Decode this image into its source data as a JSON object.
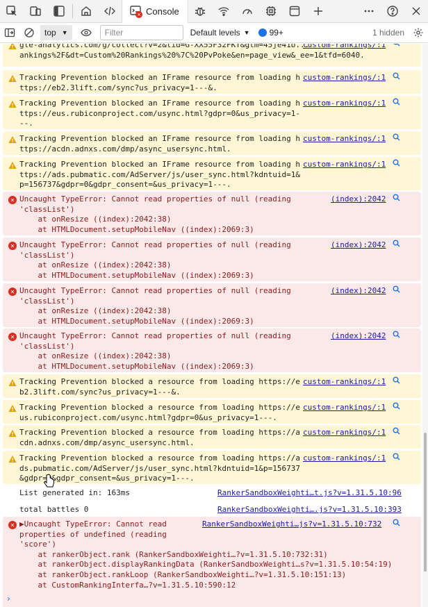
{
  "tabs": {
    "console_label": "Console",
    "console_badge": "×"
  },
  "toolbar": {
    "context": "top",
    "filter_placeholder": "Filter",
    "levels": "Default levels",
    "issues_count": "99+",
    "hidden": "1 hidden"
  },
  "messages": [
    {
      "level": "warn",
      "text": "gle-analytics.com/g/collect?v=2&tid=G-XX55F32FKT&gtm=45je41o...\nankings%2F&dt=Custom%20Rankings%20%7C%20PvPoke&en=page_view&_ee=1&tfd=6040.",
      "src": "custom-rankings/:1"
    },
    {
      "level": "warn",
      "text": "Tracking Prevention blocked an IFrame resource from loading h\nttps://eb2.3lift.com/sync?us_privacy=1---&.",
      "src": "custom-rankings/:1"
    },
    {
      "level": "warn",
      "text": "Tracking Prevention blocked an IFrame resource from loading h\nttps://eus.rubiconproject.com/usync.html?gdpr=0&us_privacy=1-\n--.",
      "src": "custom-rankings/:1"
    },
    {
      "level": "warn",
      "text": "Tracking Prevention blocked an IFrame resource from loading h\nttps://acdn.adnxs.com/dmp/async_usersync.html.",
      "src": "custom-rankings/:1"
    },
    {
      "level": "warn",
      "text": "Tracking Prevention blocked an IFrame resource from loading h\nttps://ads.pubmatic.com/AdServer/js/user_sync.html?kdntuid=1&\np=156737&gdpr=0&gdpr_consent=&us_privacy=1---.",
      "src": "custom-rankings/:1"
    },
    {
      "level": "err",
      "text": "Uncaught TypeError: Cannot read properties of null (reading\n'classList')\n    at onResize ((index):2042:38)\n    at HTMLDocument.setupMobileNav ((index):2069:3)",
      "src": "(index):2042"
    },
    {
      "level": "err",
      "text": "Uncaught TypeError: Cannot read properties of null (reading\n'classList')\n    at onResize ((index):2042:38)\n    at HTMLDocument.setupMobileNav ((index):2069:3)",
      "src": "(index):2042"
    },
    {
      "level": "err",
      "text": "Uncaught TypeError: Cannot read properties of null (reading\n'classList')\n    at onResize ((index):2042:38)\n    at HTMLDocument.setupMobileNav ((index):2069:3)",
      "src": "(index):2042"
    },
    {
      "level": "err",
      "text": "Uncaught TypeError: Cannot read properties of null (reading\n'classList')\n    at onResize ((index):2042:38)\n    at HTMLDocument.setupMobileNav ((index):2069:3)",
      "src": "(index):2042"
    },
    {
      "level": "warn",
      "text": "Tracking Prevention blocked a resource from loading https://e\nb2.3lift.com/sync?us_privacy=1---&.",
      "src": "custom-rankings/:1"
    },
    {
      "level": "warn",
      "text": "Tracking Prevention blocked a resource from loading https://e\nus.rubiconproject.com/usync.html?gdpr=0&us_privacy=1---.",
      "src": "custom-rankings/:1"
    },
    {
      "level": "warn",
      "text": "Tracking Prevention blocked a resource from loading https://a\ncdn.adnxs.com/dmp/async_usersync.html.",
      "src": "custom-rankings/:1"
    },
    {
      "level": "warn",
      "text": "Tracking Prevention blocked a resource from loading https://a\nds.pubmatic.com/AdServer/js/user_sync.html?kdntuid=1&p=156737\n&gdpr=0&gdpr_consent=&us_privacy=1---.",
      "src": "custom-rankings/:1"
    },
    {
      "level": "log",
      "text": "List generated in: 163ms",
      "src": "RankerSandboxWeighti…t.js?v=1.31.5.10:96"
    },
    {
      "level": "log",
      "text": "total battles 0",
      "src": "RankerSandboxWeighti….js?v=1.31.5.10:393"
    },
    {
      "level": "err",
      "text": "▶Uncaught TypeError: Cannot read\nproperties of undefined (reading\n'score')\n    at rankerObject.rank (RankerSandboxWeighti…?v=1.31.5.10:732:31)\n    at rankerObject.displayRankingData (RankerSandboxWeighti…s?v=1.31.5.10:54:19)\n    at rankerObject.rankLoop (RankerSandboxWeighti…?v=1.31.5.10:151:13)\n    at CustomRankingInterfa…?v=1.31.5.10:590:12",
      "src": "RankerSandboxWeighti…js?v=1.31.5.10:732"
    }
  ],
  "prompt_symbol": "›"
}
